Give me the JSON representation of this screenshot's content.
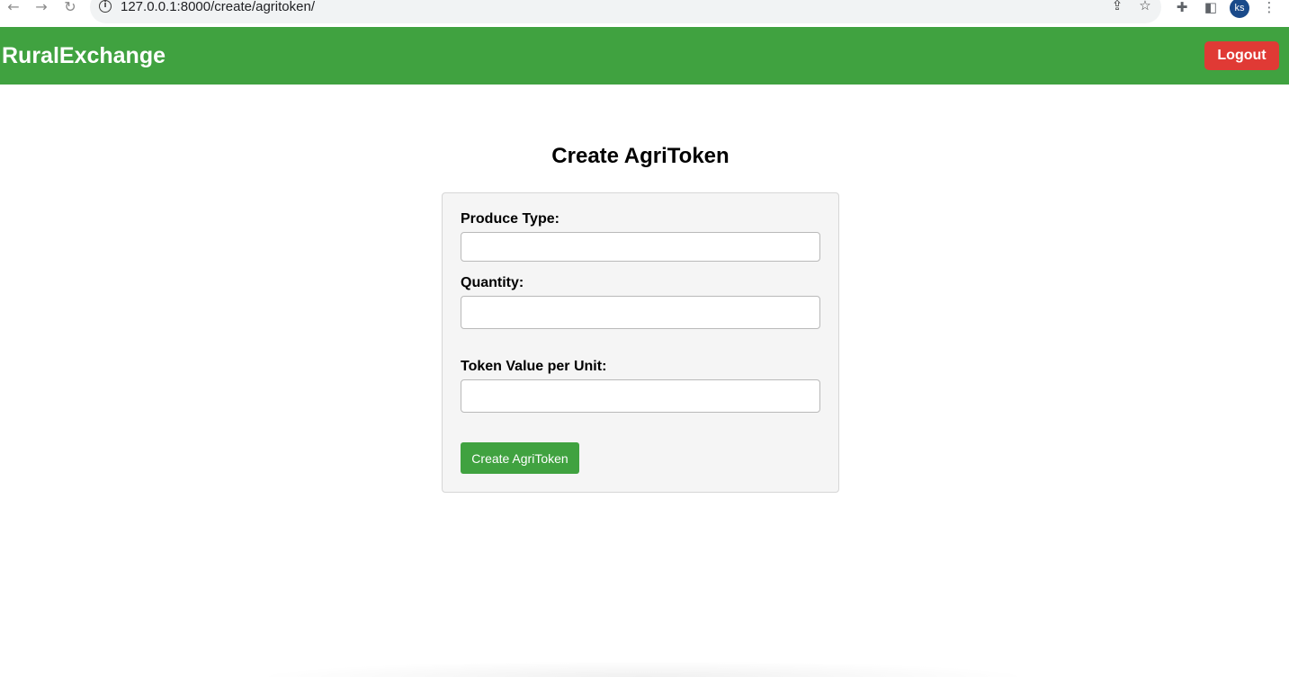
{
  "browser": {
    "back_icon": "←",
    "forward_icon": "→",
    "reload_icon": "↻",
    "info_icon": "i",
    "url": "127.0.0.1:8000/create/agritoken/",
    "share_icon": "⇪",
    "star_icon": "☆",
    "extensions_icon": "✚",
    "sidepanel_icon": "◧",
    "profile_initials": "ks",
    "menu_icon": "⋮"
  },
  "header": {
    "brand": "RuralExchange",
    "logout_label": "Logout",
    "bg_color": "#40a240",
    "logout_color": "#e03a35"
  },
  "main": {
    "title": "Create AgriToken",
    "fields": [
      {
        "label": "Produce Type:",
        "value": ""
      },
      {
        "label": "Quantity:",
        "value": ""
      },
      {
        "label": "Token Value per Unit:",
        "value": ""
      }
    ],
    "submit_label": "Create AgriToken"
  }
}
